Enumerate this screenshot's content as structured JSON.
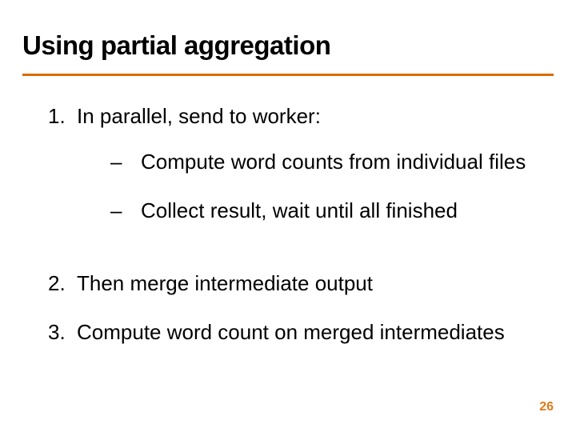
{
  "title": "Using partial aggregation",
  "items": {
    "one": {
      "num": "1.",
      "text": "In parallel, send to worker:",
      "sub": {
        "a": {
          "dash": "–",
          "text": "Compute word counts from individual files"
        },
        "b": {
          "dash": "–",
          "text": "Collect result, wait until all finished"
        }
      }
    },
    "two": {
      "num": "2.",
      "text": "Then merge intermediate output"
    },
    "three": {
      "num": "3.",
      "text": "Compute word count on merged intermediates"
    }
  },
  "page_number": "26"
}
